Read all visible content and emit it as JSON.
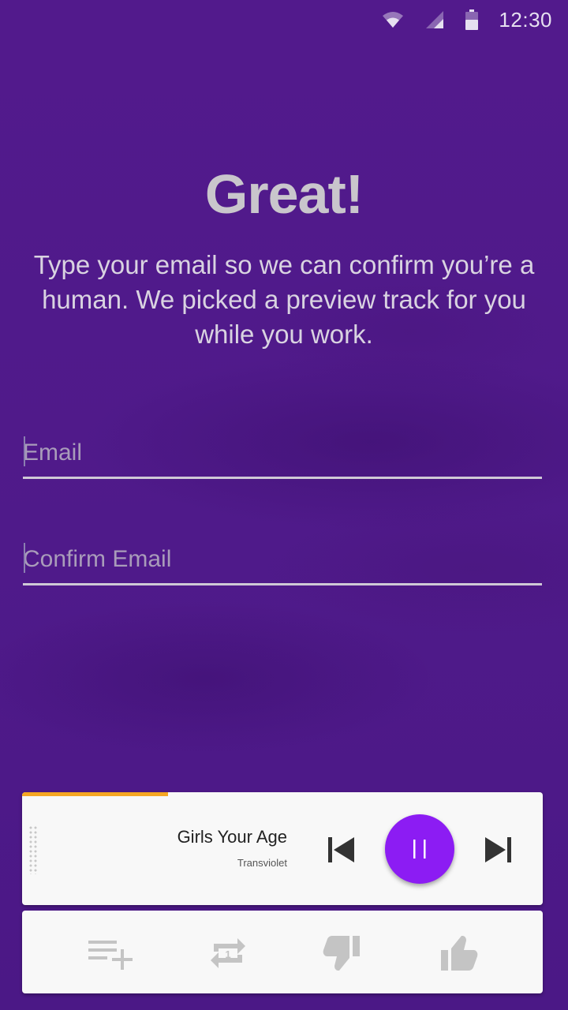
{
  "status_bar": {
    "time": "12:30",
    "icons": [
      "wifi-icon",
      "signal-icon",
      "battery-icon"
    ]
  },
  "heading": "Great!",
  "description": "Type your email so we can confirm you’re a human. We picked a preview track for you while you work.",
  "form": {
    "email_placeholder": "Email",
    "email_value": "",
    "confirm_placeholder": "Confirm Email",
    "confirm_value": ""
  },
  "player": {
    "track_title": "Girls Your Age",
    "artist": "Transviolet",
    "progress_fraction": 0.28,
    "state": "playing",
    "controls": [
      "skip-previous-icon",
      "pause-icon",
      "skip-next-icon"
    ]
  },
  "actions": [
    "add-to-queue-icon",
    "repeat-one-icon",
    "thumb-down-icon",
    "thumb-up-icon"
  ],
  "colors": {
    "background": "#4e1a89",
    "accent": "#8c1cf3",
    "progress": "#f5a623",
    "card": "#f8f8f8",
    "action_icon": "#c4c4c4"
  }
}
